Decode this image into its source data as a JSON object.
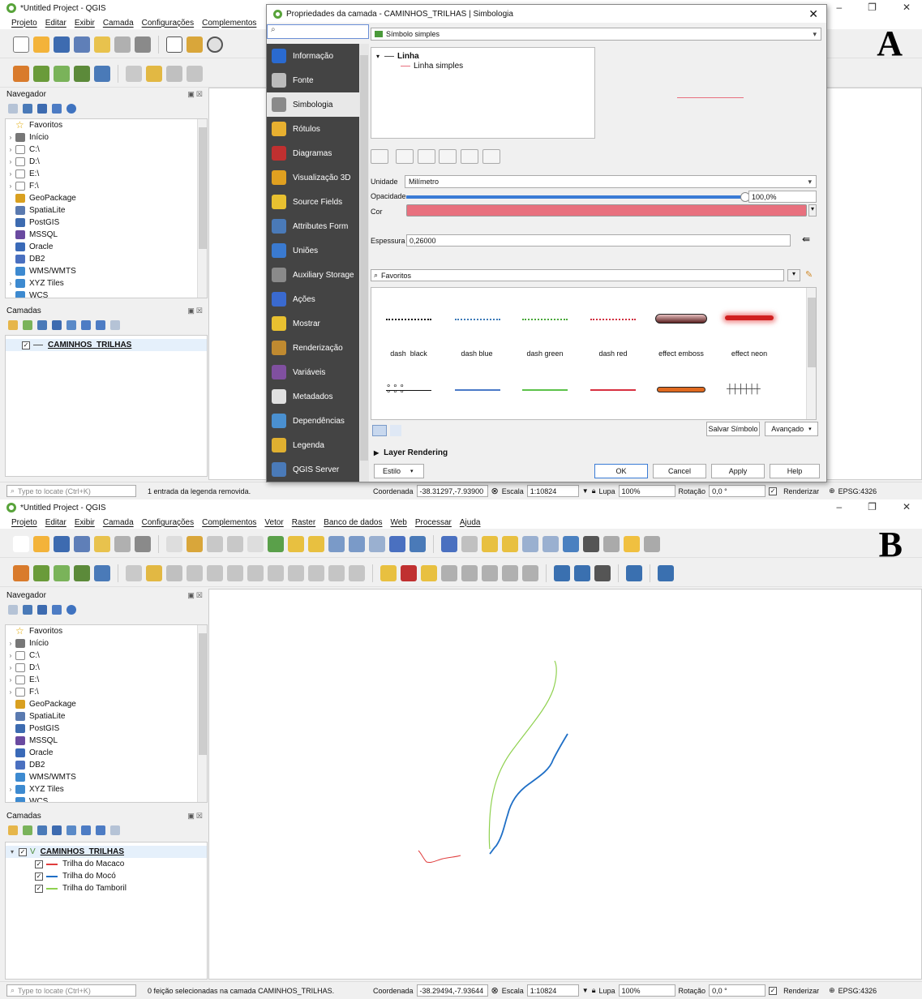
{
  "panel_a": {
    "letter": "A",
    "window_title": "*Untitled Project - QGIS",
    "menu_visible": [
      "Projeto",
      "Editar",
      "Exibir",
      "Camada",
      "Configurações",
      "Complementos"
    ],
    "browser": {
      "title": "Navegador",
      "items": [
        "Favoritos",
        "Início",
        "C:\\",
        "D:\\",
        "E:\\",
        "F:\\",
        "GeoPackage",
        "SpatiaLite",
        "PostGIS",
        "MSSQL",
        "Oracle",
        "DB2",
        "WMS/WMTS",
        "XYZ Tiles",
        "WCS"
      ]
    },
    "layers": {
      "title": "Camadas",
      "layer": "CAMINHOS_TRILHAS"
    },
    "status": {
      "locate_placeholder": "Type to locate (Ctrl+K)",
      "message": "1 entrada da legenda removida.",
      "coord_label": "Coordenada",
      "coord_value": "-38.31297,-7.93900",
      "scale_label": "Escala",
      "scale_value": "1:10824",
      "magnifier_label": "Lupa",
      "magnifier_value": "100%",
      "rotation_label": "Rotação",
      "rotation_value": "0,0 °",
      "render_label": "Renderizar",
      "crs": "EPSG:4326"
    },
    "dialog": {
      "title": "Propriedades da camada - CAMINHOS_TRILHAS | Simbologia",
      "nav": [
        "Informação",
        "Fonte",
        "Simbologia",
        "Rótulos",
        "Diagramas",
        "Visualização 3D",
        "Source Fields",
        "Attributes Form",
        "Uniões",
        "Auxiliary Storage",
        "Ações",
        "Mostrar",
        "Renderização",
        "Variáveis",
        "Metadados",
        "Dependências",
        "Legenda",
        "QGIS Server"
      ],
      "nav_selected": "Simbologia",
      "renderer": "Símbolo simples",
      "tree_root": "Linha",
      "tree_child": "Linha simples",
      "unit_label": "Unidade",
      "unit_value": "Milímetro",
      "opacity_label": "Opacidade",
      "opacity_value": "100,0%",
      "opacity_fraction": 1.0,
      "color_label": "Cor",
      "color_hex": "#e8707e",
      "width_label": "Espessura",
      "width_value": "0,26000",
      "favorites_search": "Favoritos",
      "symbols": [
        "dash  black",
        "dash blue",
        "dash green",
        "dash red",
        "effect emboss",
        "effect neon"
      ],
      "save_symbol": "Salvar Símbolo",
      "advanced": "Avançado",
      "layer_rendering": "Layer Rendering",
      "style_button": "Estilo",
      "ok": "OK",
      "cancel": "Cancel",
      "apply": "Apply",
      "help": "Help"
    }
  },
  "panel_b": {
    "letter": "B",
    "window_title": "*Untitled Project - QGIS",
    "menu": [
      "Projeto",
      "Editar",
      "Exibir",
      "Camada",
      "Configurações",
      "Complementos",
      "Vetor",
      "Raster",
      "Banco de dados",
      "Web",
      "Processar",
      "Ajuda"
    ],
    "browser": {
      "title": "Navegador",
      "items": [
        "Favoritos",
        "Início",
        "C:\\",
        "D:\\",
        "E:\\",
        "F:\\",
        "GeoPackage",
        "SpatiaLite",
        "PostGIS",
        "MSSQL",
        "Oracle",
        "DB2",
        "WMS/WMTS",
        "XYZ Tiles",
        "WCS"
      ]
    },
    "layers": {
      "title": "Camadas",
      "group": "CAMINHOS_TRILHAS",
      "categories": [
        {
          "label": "Trilha do Macaco",
          "color": "#e03c3c"
        },
        {
          "label": "Trilha do Mocó",
          "color": "#1f6fc6"
        },
        {
          "label": "Trilha do Tamboril",
          "color": "#8fd14f"
        }
      ]
    },
    "status": {
      "locate_placeholder": "Type to locate (Ctrl+K)",
      "message": "0 feição selecionadas na camada CAMINHOS_TRILHAS.",
      "coord_label": "Coordenada",
      "coord_value": "-38.29494,-7.93644",
      "scale_label": "Escala",
      "scale_value": "1:10824",
      "magnifier_label": "Lupa",
      "magnifier_value": "100%",
      "rotation_label": "Rotação",
      "rotation_value": "0,0 °",
      "render_label": "Renderizar",
      "crs": "EPSG:4326"
    }
  }
}
